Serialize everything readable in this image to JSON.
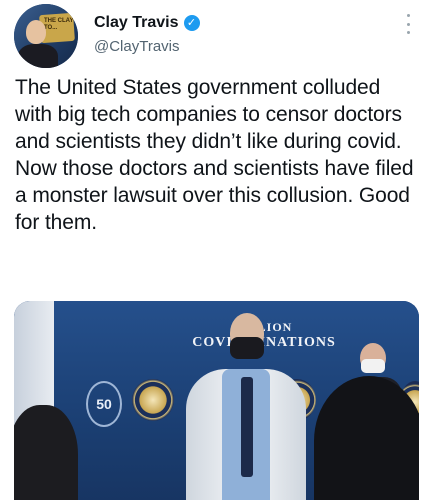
{
  "author": {
    "name": "Clay Travis",
    "handle": "@ClayTravis",
    "verified_icon": "✓",
    "avatar_sign_text": "THE CLAY TO..."
  },
  "tweet": {
    "text": "The United States government colluded with big tech companies to censor doctors and scientists they didn’t like during covid. Now those doctors and scientists have filed a monster lawsuit over this collusion. Good for them."
  },
  "media": {
    "banner_line1": "SO    LION",
    "banner_line2": "COVID    CINATIONS",
    "badge_number": "50"
  },
  "colors": {
    "accent": "#1d9bf0",
    "text": "#0f1419",
    "secondary": "#536471"
  }
}
